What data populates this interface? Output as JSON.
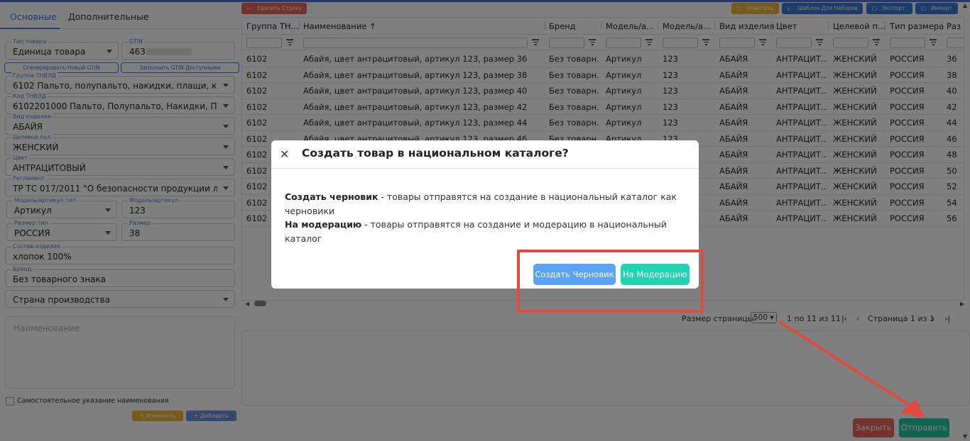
{
  "left_panel": {
    "tabs": [
      "Основные",
      "Дополнительные"
    ],
    "fields": {
      "product_type": {
        "label": "Тип товара",
        "value": "Единица товара"
      },
      "gtin": {
        "label": "GTIN",
        "value": "463"
      },
      "tnved_group": {
        "label": "Группа ТНВЭД",
        "value": "6102 Пальто, полупальто, накидки, плащи, курт..."
      },
      "tnved_code": {
        "label": "Код ТНВЭД",
        "value": "6102201000 Пальто, Полупальто, Накидки, Пла..."
      },
      "item_kind": {
        "label": "Вид изделия",
        "value": "АБАЙЯ"
      },
      "gender": {
        "label": "Целевой пол",
        "value": "ЖЕНСКИЙ"
      },
      "color": {
        "label": "Цвет",
        "value": "АНТРАЦИТОВЫЙ"
      },
      "regulation": {
        "label": "Регламент",
        "value": "ТР ТС 017/2011 \"О безопасности продукции лег..."
      },
      "model_type": {
        "label": "Модель/артикул тип",
        "value": "Артикул"
      },
      "model": {
        "label": "Модель/артикул",
        "value": "123"
      },
      "size_type": {
        "label": "Размер тип",
        "value": "РОССИЯ"
      },
      "size": {
        "label": "Размер",
        "value": "38"
      },
      "composition": {
        "label": "Состав изделия",
        "value": "хлопок 100%"
      },
      "brand": {
        "label": "Бренд",
        "value": "Без товарного знака"
      },
      "country": {
        "value": "Страна производства"
      }
    },
    "gen_gtin_button": "Сгенерировать Новый GTIN",
    "fill_gtin_button": "Заполнить GTIN Доступными",
    "name_placeholder": "Наименование",
    "manual_name_label": "Самостоятельное указание наименования",
    "edit_button": "Изменить",
    "add_button": "Добавить"
  },
  "toolbar": {
    "delete_row": "Удалить Строку",
    "clear": "Очистить",
    "template": "Шаблон Для Наборов",
    "export": "Экспорт",
    "import": "Импорт"
  },
  "grid": {
    "columns": [
      "Группа ТН...",
      "Наименование ↑",
      "Бренд",
      "Модель/а...",
      "Модель/а...",
      "Вид изделия",
      "Цвет",
      "Целевой п...",
      "Тип размера",
      "Раз"
    ],
    "rows": [
      [
        "6102",
        "Абайя, цвет антрацитовый, артикул 123, размер 36",
        "Без товарн...",
        "Артикул",
        "123",
        "АБАЙЯ",
        "АНТРАЦИТ...",
        "ЖЕНСКИЙ",
        "РОССИЯ",
        "36"
      ],
      [
        "6102",
        "Абайя, цвет антрацитовый, артикул 123, размер 38",
        "Без товарн...",
        "Артикул",
        "123",
        "АБАЙЯ",
        "АНТРАЦИТ...",
        "ЖЕНСКИЙ",
        "РОССИЯ",
        "38"
      ],
      [
        "6102",
        "Абайя, цвет антрацитовый, артикул 123, размер 40",
        "Без товарн...",
        "Артикул",
        "123",
        "АБАЙЯ",
        "АНТРАЦИТ...",
        "ЖЕНСКИЙ",
        "РОССИЯ",
        "40"
      ],
      [
        "6102",
        "Абайя, цвет антрацитовый, артикул 123, размер 42",
        "Без товарн...",
        "Артикул",
        "123",
        "АБАЙЯ",
        "АНТРАЦИТ...",
        "ЖЕНСКИЙ",
        "РОССИЯ",
        "42"
      ],
      [
        "6102",
        "Абайя, цвет антрацитовый, артикул 123, размер 44",
        "Без товарн...",
        "Артикул",
        "123",
        "АБАЙЯ",
        "АНТРАЦИТ...",
        "ЖЕНСКИЙ",
        "РОССИЯ",
        "44"
      ],
      [
        "6102",
        "Абайя, цвет антрацитовый, артикул 123, размер 46",
        "Без товарн...",
        "Артикул",
        "123",
        "АБАЙЯ",
        "АНТРАЦИТ...",
        "ЖЕНСКИЙ",
        "РОССИЯ",
        "46"
      ],
      [
        "6102",
        "",
        "",
        "",
        "",
        "АБАЙЯ",
        "АНТРАЦИТ...",
        "ЖЕНСКИЙ",
        "РОССИЯ",
        "48"
      ],
      [
        "6102",
        "",
        "",
        "",
        "",
        "АБАЙЯ",
        "АНТРАЦИТ...",
        "ЖЕНСКИЙ",
        "РОССИЯ",
        "50"
      ],
      [
        "6102",
        "",
        "",
        "",
        "",
        "АБАЙЯ",
        "АНТРАЦИТ...",
        "ЖЕНСКИЙ",
        "РОССИЯ",
        "52"
      ],
      [
        "6102",
        "",
        "",
        "",
        "",
        "АБАЙЯ",
        "АНТРАЦИТ...",
        "ЖЕНСКИЙ",
        "РОССИЯ",
        "54"
      ],
      [
        "6102",
        "",
        "",
        "",
        "",
        "АБАЙЯ",
        "АНТРАЦИТ...",
        "ЖЕНСКИЙ",
        "РОССИЯ",
        "56"
      ]
    ]
  },
  "pager": {
    "page_size_label": "Размер страницы:",
    "page_size": "500",
    "range": "1 по 11 из 11",
    "page": "Страница 1 из 1"
  },
  "modal": {
    "title": "Создать товар в национальном каталоге?",
    "draft_bold": "Создать черновик",
    "draft_text": " - товары отправятся на создание в национальный каталог как черновики",
    "moderation_bold": "На модерацию",
    "moderation_text": " - товары отправятся на создание и модерацию в национальный каталог",
    "draft_button": "Создать Черновик",
    "moderation_button": "На Модерацию"
  },
  "footer": {
    "close_button": "Закрыть",
    "send_button": "Отправить"
  },
  "colors": {
    "primary": "#3a78d8",
    "danger": "#e8655a",
    "teal": "#22d3b0",
    "blue_button": "#5aa2f5",
    "annotation": "#e04b3e"
  }
}
